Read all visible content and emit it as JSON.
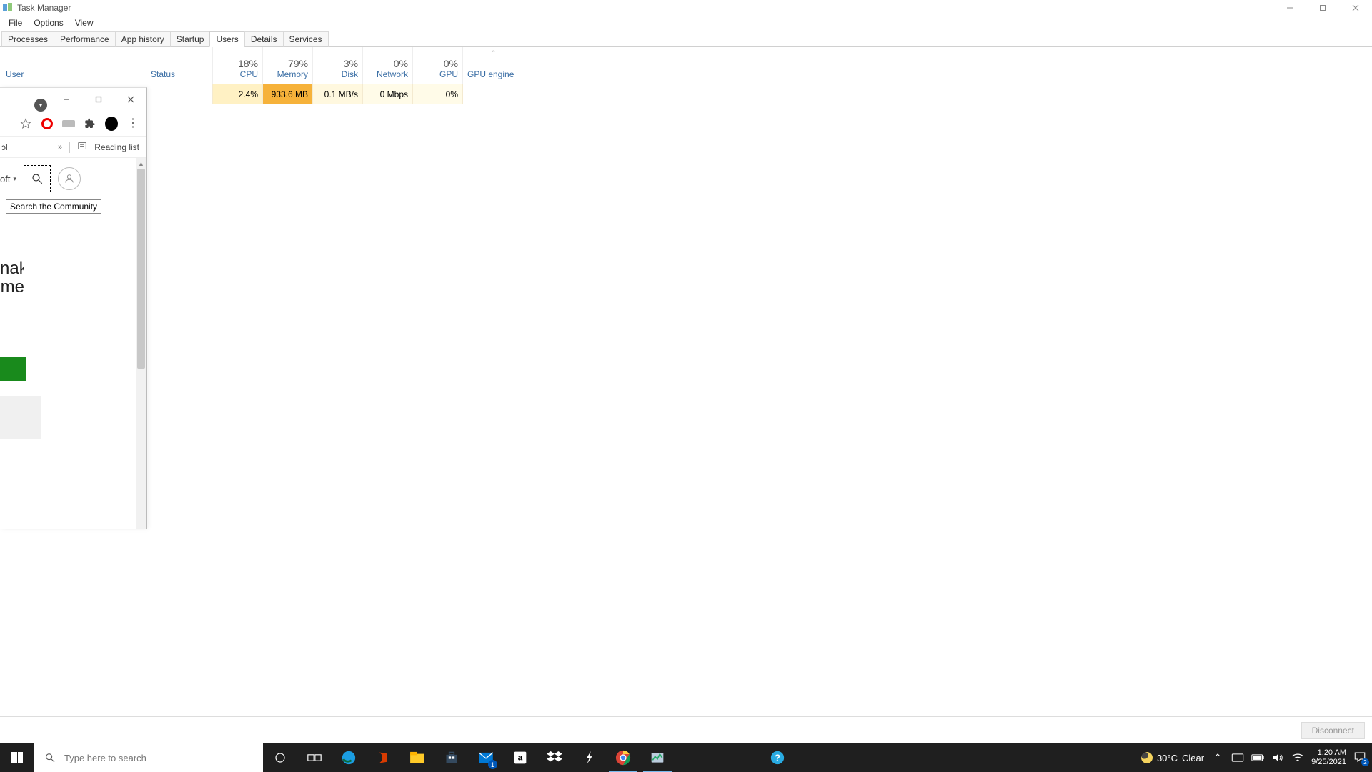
{
  "window": {
    "title": "Task Manager"
  },
  "menu": {
    "file": "File",
    "options": "Options",
    "view": "View"
  },
  "tabs": {
    "processes": "Processes",
    "performance": "Performance",
    "app_history": "App history",
    "startup": "Startup",
    "users": "Users",
    "details": "Details",
    "services": "Services"
  },
  "headers": {
    "user": "User",
    "status": "Status",
    "cpu_pct": "18%",
    "cpu": "CPU",
    "mem_pct": "79%",
    "mem": "Memory",
    "disk_pct": "3%",
    "disk": "Disk",
    "net_pct": "0%",
    "net": "Network",
    "gpu_pct": "0%",
    "gpu": "GPU",
    "gpu_engine": "GPU engine"
  },
  "row": {
    "cpu": "2.4%",
    "mem": "933.6 MB",
    "disk": "0.1 MB/s",
    "net": "0 Mbps",
    "gpu": "0%"
  },
  "footer": {
    "disconnect": "Disconnect"
  },
  "browser": {
    "reading_list": "Reading list",
    "oft": "oft",
    "tooltip": "Search the Community",
    "frag1": "nake",
    "frag2": "me"
  },
  "taskbar": {
    "search_placeholder": "Type here to search",
    "weather_temp": "30°C",
    "weather_cond": "Clear",
    "time": "1:20 AM",
    "date": "9/25/2021",
    "mail_badge": "1",
    "notif_badge": "2"
  }
}
